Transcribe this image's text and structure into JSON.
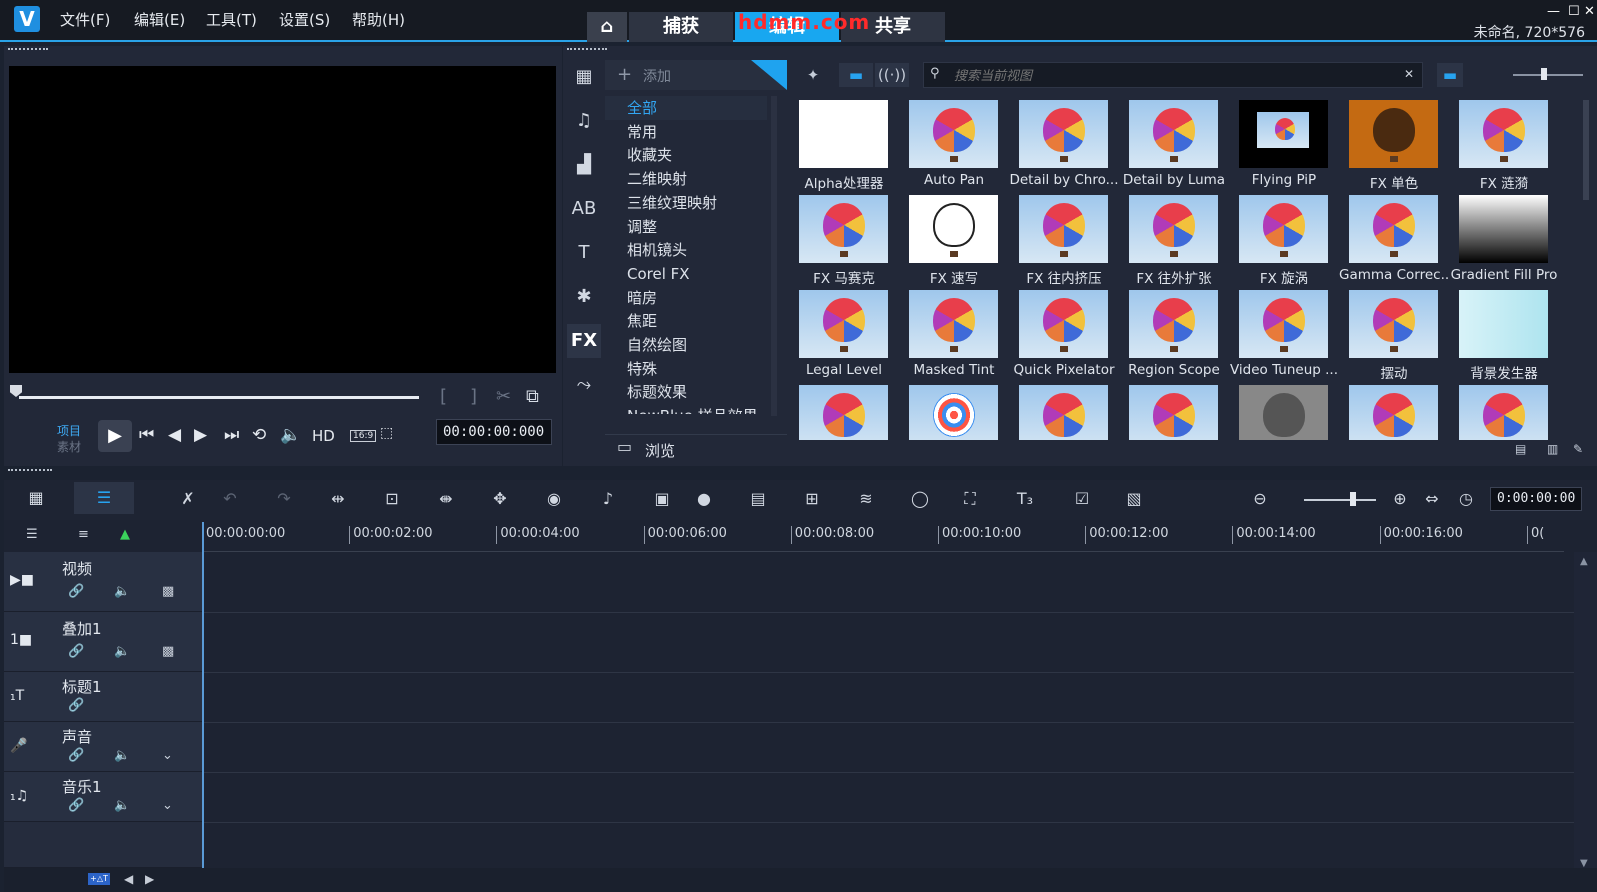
{
  "menu": {
    "items": [
      "文件(F)",
      "编辑(E)",
      "工具(T)",
      "设置(S)",
      "帮助(H)"
    ]
  },
  "tabs": {
    "capture": "捕获",
    "edit": "编辑",
    "share": "共享"
  },
  "watermark": "hdmm.com",
  "project_info": "未命名, 720*576",
  "preview": {
    "mode_project": "项目",
    "mode_clip": "素材",
    "hd_label": "HD",
    "aspect_label": "16:9",
    "timecode": "00:00:00:000"
  },
  "library": {
    "add_label": "添加",
    "browse_label": "浏览",
    "search_placeholder": "搜索当前视图",
    "active_side_tab": "FX",
    "categories": [
      "全部",
      "常用",
      "收藏夹",
      "二维映射",
      "三维纹理映射",
      "调整",
      "相机镜头",
      "Corel FX",
      "暗房",
      "焦距",
      "自然绘图",
      "特殊",
      "标题效果",
      "NewBlue 样品效果"
    ],
    "selected_category": "全部",
    "filters": [
      "Alpha处理器",
      "Auto Pan",
      "Detail by Chro...",
      "Detail by Luma",
      "Flying PiP",
      "FX 单色",
      "FX 涟漪",
      "FX 马赛克",
      "FX 速写",
      "FX 往内挤压",
      "FX 往外扩张",
      "FX 旋涡",
      "Gamma Correc...",
      "Gradient Fill Pro",
      "Legal Level",
      "Masked Tint",
      "Quick Pixelator",
      "Region Scope",
      "Video Tuneup ...",
      "摆动",
      "背景发生器",
      "",
      "",
      "",
      "",
      "",
      "",
      ""
    ]
  },
  "timeline": {
    "timecode": "0:00:00:00",
    "ruler_ticks": [
      "00:00:00:00",
      "00:00:02:00",
      "00:00:04:00",
      "00:00:06:00",
      "00:00:08:00",
      "00:00:10:00",
      "00:00:12:00",
      "00:00:14:00",
      "00:00:16:00"
    ],
    "ruler_end": "0(",
    "tracks": [
      {
        "name": "视频"
      },
      {
        "name": "叠加1"
      },
      {
        "name": "标题1"
      },
      {
        "name": "声音"
      },
      {
        "name": "音乐1"
      }
    ],
    "status_badge": "+△T"
  }
}
